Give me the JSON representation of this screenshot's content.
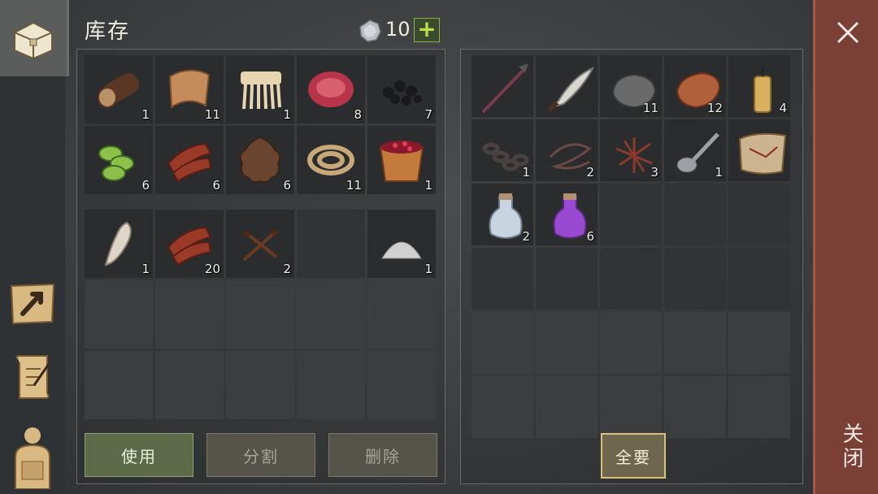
{
  "header": {
    "title": "库存",
    "currency_count": "10",
    "add_label": "+"
  },
  "sidebar": {
    "items": [
      {
        "name": "inventory-chest-icon"
      },
      {
        "name": "crafting-map-icon"
      },
      {
        "name": "quest-scroll-icon"
      },
      {
        "name": "character-backpack-icon"
      }
    ]
  },
  "inventory": {
    "section1": [
      {
        "name": "log-icon",
        "count": "1"
      },
      {
        "name": "leather-strip-icon",
        "count": "11"
      },
      {
        "name": "bone-comb-icon",
        "count": "1"
      },
      {
        "name": "raw-meat-icon",
        "count": "8"
      },
      {
        "name": "coal-icon",
        "count": "7"
      },
      {
        "name": "cucumber-slices-icon",
        "count": "6"
      },
      {
        "name": "meat-strips-icon",
        "count": "6"
      },
      {
        "name": "animal-hide-icon",
        "count": "6"
      },
      {
        "name": "rope-icon",
        "count": "11"
      },
      {
        "name": "berry-bucket-icon",
        "count": "1"
      }
    ],
    "section2": [
      {
        "name": "fang-icon",
        "count": "1"
      },
      {
        "name": "meat-strips-icon",
        "count": "20"
      },
      {
        "name": "nails-icon",
        "count": "2"
      },
      {
        "name": "empty",
        "count": ""
      },
      {
        "name": "salt-pile-icon",
        "count": "1"
      }
    ]
  },
  "loot": [
    {
      "name": "spear-icon",
      "count": ""
    },
    {
      "name": "machete-icon",
      "count": ""
    },
    {
      "name": "stone-icon",
      "count": "11"
    },
    {
      "name": "copper-ingot-icon",
      "count": "12"
    },
    {
      "name": "candle-icon",
      "count": "4"
    },
    {
      "name": "chain-icon",
      "count": "1"
    },
    {
      "name": "wire-icon",
      "count": "2"
    },
    {
      "name": "tangled-wire-icon",
      "count": "3"
    },
    {
      "name": "spoon-icon",
      "count": "1"
    },
    {
      "name": "old-map-icon",
      "count": ""
    },
    {
      "name": "water-bottle-icon",
      "count": "2"
    },
    {
      "name": "purple-potion-icon",
      "count": "6"
    }
  ],
  "buttons": {
    "use": "使用",
    "split": "分割",
    "delete": "删除",
    "take_all": "全要"
  },
  "close": {
    "label": "关闭"
  },
  "colors": {
    "accent_green": "#8cae4a",
    "close_bar": "#7a4036",
    "take_all_border": "#d8c27a"
  }
}
